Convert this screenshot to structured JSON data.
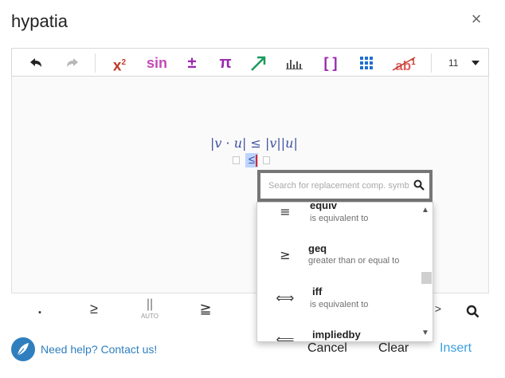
{
  "app": {
    "title": "hypatia",
    "close_glyph": "×"
  },
  "toolbar": {
    "undo_icon": "undo-icon",
    "redo_icon": "redo-icon",
    "superscript_label": "x",
    "superscript_exp": "2",
    "sin_label": "sin",
    "plusminus_label": "±",
    "pi_label": "π",
    "arrow_icon": "arrow-icon",
    "bars_icon": "bar-chart-icon",
    "brackets_label": "[ ]",
    "grid_icon": "grid-icon",
    "strike_label": "ab",
    "strike_exp": "1",
    "font_size": "11",
    "colors": {
      "red": "#c0392b",
      "purple": "#9b27af",
      "green": "#1a9a5c",
      "blue": "#1f6fd1"
    }
  },
  "editor": {
    "math_expression": "|v · u| ≤ |v||u|",
    "selected_symbol": "≤"
  },
  "search": {
    "placeholder": "Search for replacement comp. symb"
  },
  "dropdown": {
    "items": [
      {
        "symbol": "≡",
        "name": "equiv",
        "description": "is equivalent to"
      },
      {
        "symbol": "≥",
        "name": "geq",
        "description": "greater than or equal to"
      },
      {
        "symbol": "⟺",
        "name": "iff",
        "description": "is equivalent to"
      },
      {
        "symbol": "⟸",
        "name": "impliedby",
        "description": ""
      }
    ],
    "scroll_position": 0.45
  },
  "bottom_toolbar": {
    "dot_label": ".",
    "geq_label": "≥",
    "parallel_label": "||",
    "auto_label": "AUTO",
    "geqq_label": "≧",
    "chevron_label": ">"
  },
  "footer": {
    "help_link": "Need help? Contact us!",
    "cancel_label": "Cancel",
    "clear_label": "Clear",
    "insert_label": "Insert",
    "insert_color": "#3aa0e0"
  }
}
